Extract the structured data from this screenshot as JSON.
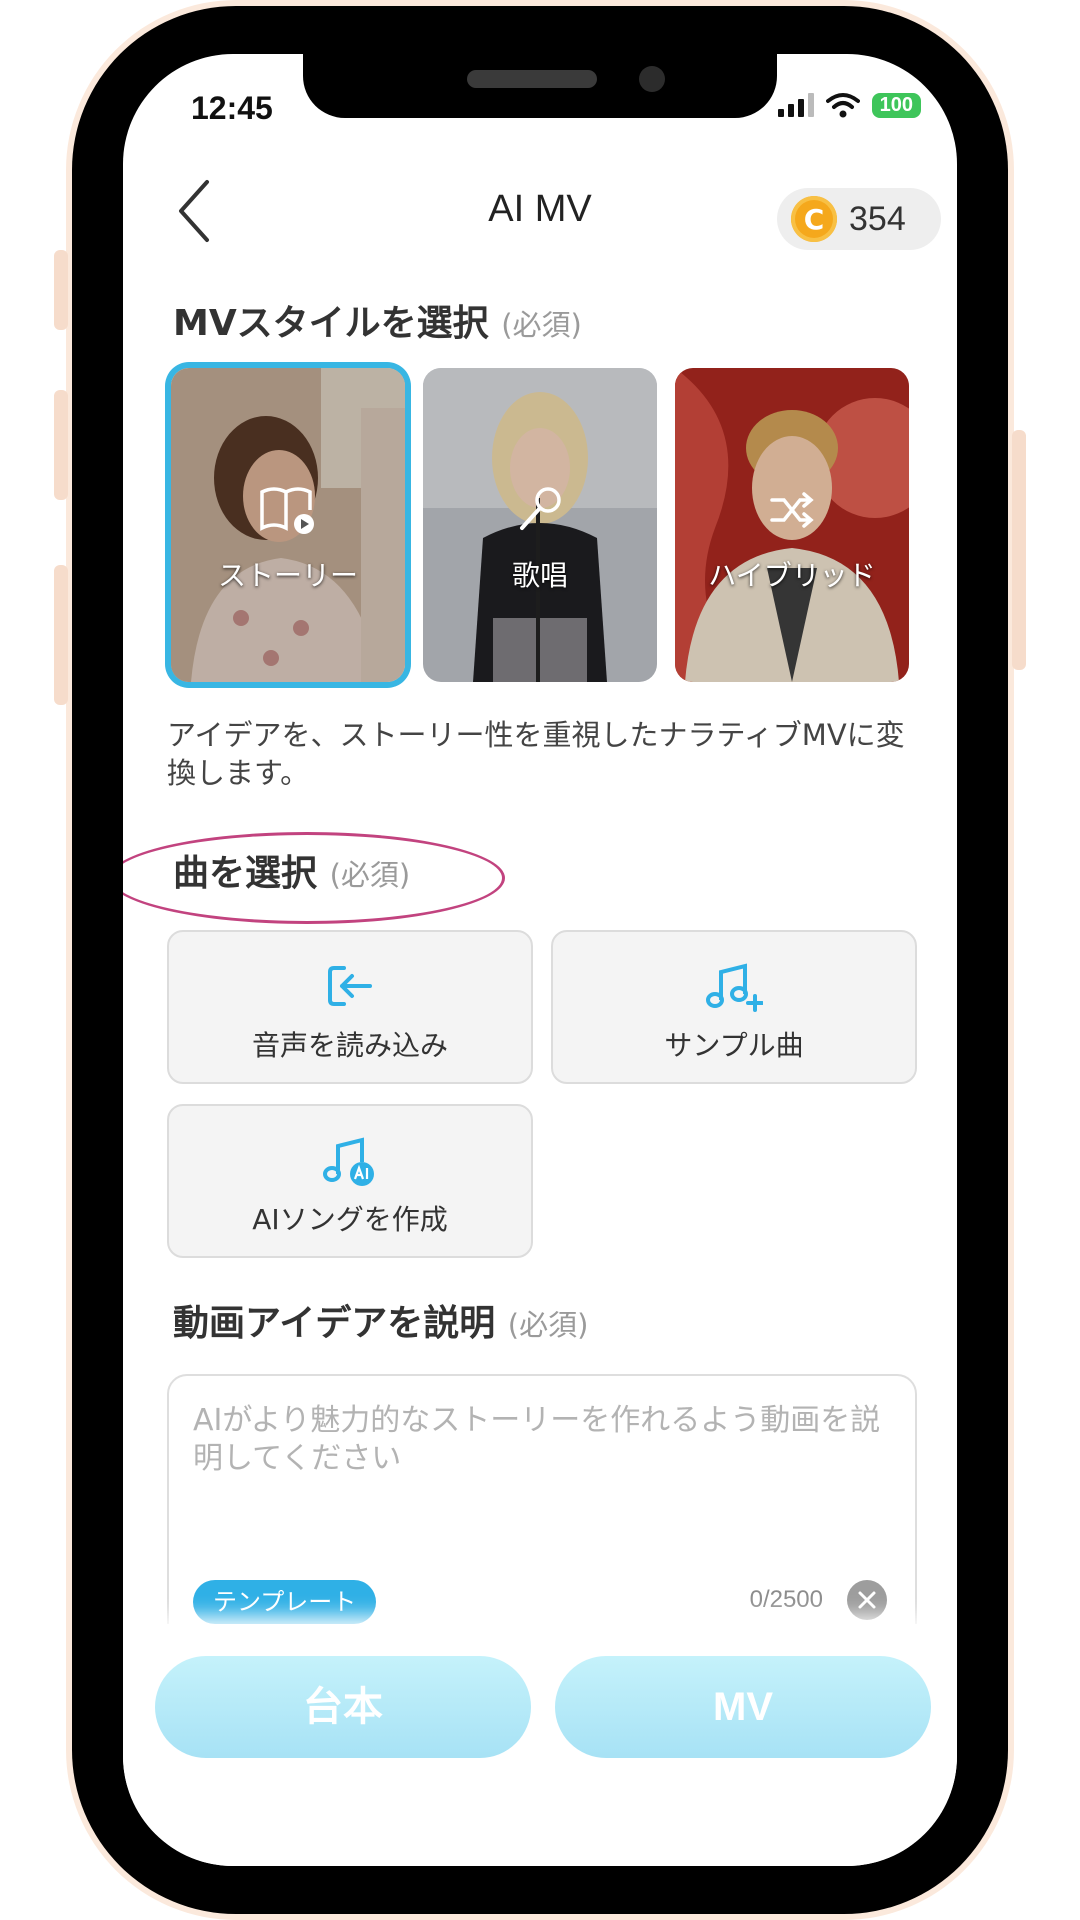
{
  "status": {
    "time": "12:45",
    "battery": "100"
  },
  "header": {
    "title": "AI MV",
    "coins": "354",
    "coin_symbol": "C"
  },
  "style_section": {
    "title": "MVスタイルを選択",
    "required": "(必須)",
    "options": [
      {
        "label": "ストーリー",
        "selected": true
      },
      {
        "label": "歌唱",
        "selected": false
      },
      {
        "label": "ハイブリッド",
        "selected": false
      }
    ],
    "description": "アイデアを、ストーリー性を重視したナラティブMVに変換します。"
  },
  "song_section": {
    "title": "曲を選択",
    "required": "(必須)",
    "buttons": [
      {
        "label": "音声を読み込み",
        "icon": "import-icon"
      },
      {
        "label": "サンプル曲",
        "icon": "music-add-icon"
      },
      {
        "label": "AIソングを作成",
        "icon": "music-ai-icon"
      }
    ]
  },
  "idea_section": {
    "title": "動画アイデアを説明",
    "required": "(必須)",
    "placeholder": "AIがより魅力的なストーリーを作れるよう動画を説明してください",
    "template_label": "テンプレート",
    "counter": "0/2500"
  },
  "footer": {
    "script_label": "台本",
    "mv_label": "MV"
  },
  "colors": {
    "accent": "#38b6e3",
    "annotation": "#c2437f",
    "coin": "#f5a81c"
  }
}
